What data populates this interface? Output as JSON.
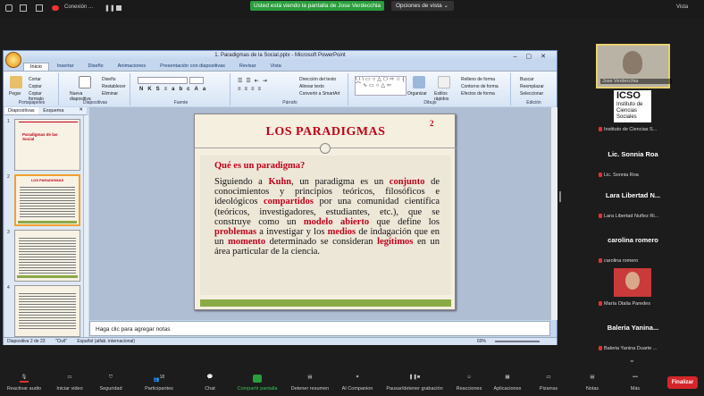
{
  "zoom_top": {
    "connection": "Conexión ...",
    "banner": "Usted está viendo la pantalla de Jose Verdecchia",
    "view_options": "Opciones de vista",
    "vista": "Vista"
  },
  "ppt": {
    "title": "1. Paradigmas de la Social.pptx - Microsoft PowerPoint",
    "tabs": [
      "Inicio",
      "Insertar",
      "Diseño",
      "Animaciones",
      "Presentación con diapositivas",
      "Revisar",
      "Vista"
    ],
    "groups": [
      "Portapapeles",
      "Diapositivas",
      "Fuente",
      "Párrafo",
      "Dibujo",
      "Edición"
    ],
    "buttons": {
      "paste": "Pegar",
      "new_slide": "Nueva diapositiva",
      "cut": "Cortar",
      "copy": "Copiar",
      "copy_format": "Copiar formato",
      "design": "Diseño",
      "reset": "Restablecer",
      "delete": "Eliminar",
      "text_direction": "Dirección del texto",
      "align_text": "Alinear texto",
      "smartart": "Convertir a SmartArt",
      "organize": "Organizar",
      "quick_styles": "Estilos rápidos",
      "shape_fill": "Relleno de forma",
      "shape_outline": "Contorno de forma",
      "shape_effects": "Efectos de forma",
      "find": "Buscar",
      "replace": "Reemplazar",
      "select": "Seleccionar"
    },
    "panel_tabs": [
      "Diapositivas",
      "Esquema"
    ],
    "thumbs": [
      {
        "num": "1",
        "title": "Paradigmas de las Social"
      },
      {
        "num": "2",
        "title": "LOS PARADIGMAS"
      },
      {
        "num": "3",
        "title": ""
      },
      {
        "num": "4",
        "title": ""
      }
    ],
    "slide": {
      "number": "2",
      "title": "LOS PARADIGMAS",
      "question": "Qué es un paradigma?"
    },
    "notes": "Haga clic para agregar notas",
    "status": {
      "slide": "Diapositiva 2 de 23",
      "theme": "\"Civil\"",
      "lang": "Español (alfab. internacional)",
      "zoom": "69%"
    }
  },
  "participants": [
    {
      "big": "",
      "small": "Jose Verdecchia"
    },
    {
      "big": "",
      "small": "Instituto de Ciencias S..."
    },
    {
      "big": "Lic. Sonnia Roa",
      "small": "Lic. Sonnia Roa"
    },
    {
      "big": "Lara Libertad N...",
      "small": "Lara Libertad Nuñez Ri..."
    },
    {
      "big": "carolina romero",
      "small": "carolina romero"
    },
    {
      "big": "",
      "small": "María Otalia Paredes"
    },
    {
      "big": "Baleria  Yanina...",
      "small": "Baleria Yanina Duarte ..."
    }
  ],
  "icso": {
    "logo": "ICSO",
    "text": "Instituto de Ciencias Sociales"
  },
  "bottom": [
    "Reactivar audio",
    "Iniciar video",
    "Seguridad",
    "Participantes",
    "Chat",
    "Compartir pantalla",
    "Detener resumen",
    "AI Companion",
    "Pausar/detener grabación",
    "Reacciones",
    "Aplicaciones",
    "Pizarras",
    "Notas",
    "Más"
  ],
  "participants_count": "18",
  "end_button": "Finalizar",
  "colors": {
    "share_green": "#2a9d3c",
    "slide_red": "#c0001a",
    "end_red": "#d4262a"
  }
}
